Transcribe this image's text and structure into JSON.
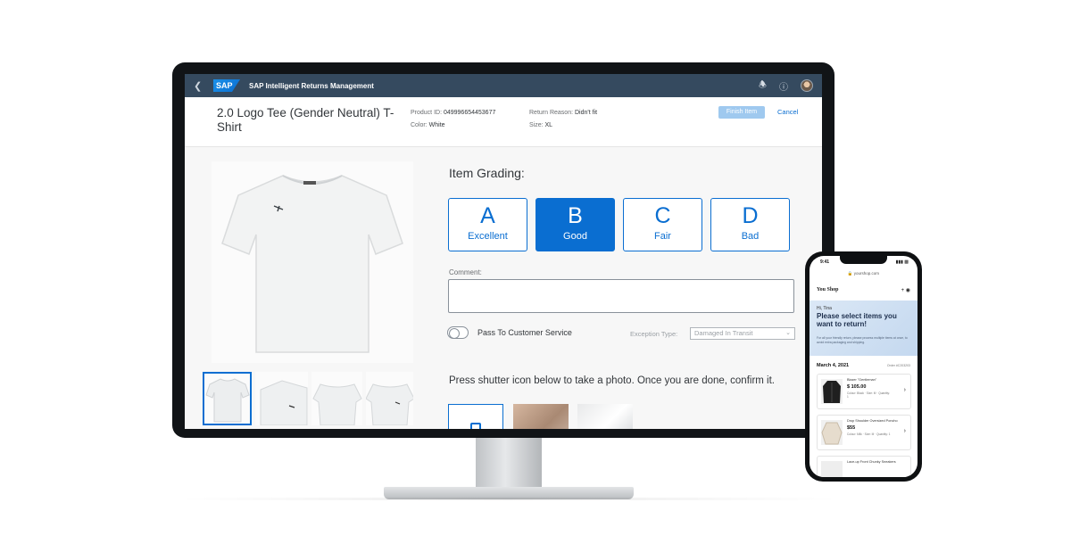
{
  "desktop": {
    "shellbar": {
      "back_icon": "chevron-left-icon",
      "logo": "SAP",
      "title": "SAP Intelligent Returns Management",
      "icons": [
        "bell-icon",
        "help-icon"
      ]
    },
    "header": {
      "title": "2.0 Logo Tee (Gender Neutral) T-Shirt",
      "product_id_label": "Product ID:",
      "product_id_value": "049996654453677",
      "color_label": "Color:",
      "color_value": "White",
      "return_reason_label": "Return Reason:",
      "return_reason_value": "Didn't fit",
      "size_label": "Size:",
      "size_value": "XL",
      "finish_button": "Finish Item",
      "cancel_button": "Cancel"
    },
    "grading": {
      "label": "Item Grading:",
      "grades": [
        {
          "letter": "A",
          "word": "Excellent",
          "selected": false
        },
        {
          "letter": "B",
          "word": "Good",
          "selected": true
        },
        {
          "letter": "C",
          "word": "Fair",
          "selected": false
        },
        {
          "letter": "D",
          "word": "Bad",
          "selected": false
        }
      ]
    },
    "comment": {
      "label": "Comment:",
      "value": ""
    },
    "pass_to_service": {
      "label": "Pass To Customer Service",
      "on": false
    },
    "exception": {
      "label": "Exception Type:",
      "value": "Damaged In Transit"
    },
    "photo_instruction": "Press shutter icon below to take a photo. Once you are done, confirm it.",
    "accent": "#0a6ed1",
    "shell_color": "#354a5f"
  },
  "phone": {
    "time": "9:41",
    "url": "yourshop.com",
    "shop_name": "You Shop",
    "greeting": "Hi, Tina",
    "headline": "Please select items you want to return!",
    "subtext": "For all your friendly return, please process multiple items at once, to avoid extra packaging and shipping.",
    "date": "March 4, 2021",
    "order": "Order #C203203",
    "items": [
      {
        "name": "Blazer \"Gentleman\"",
        "price": "$ 105.00",
        "meta": "Colour: Black · Size: M · Quantity: 1"
      },
      {
        "name": "Drop Shoulder Oversized Poncho",
        "price": "$55",
        "meta": "Colour: Milk · Size: M · Quantity: 1"
      },
      {
        "name": "Lace-up Front Chunky Sneakers",
        "price": "",
        "meta": ""
      }
    ]
  }
}
